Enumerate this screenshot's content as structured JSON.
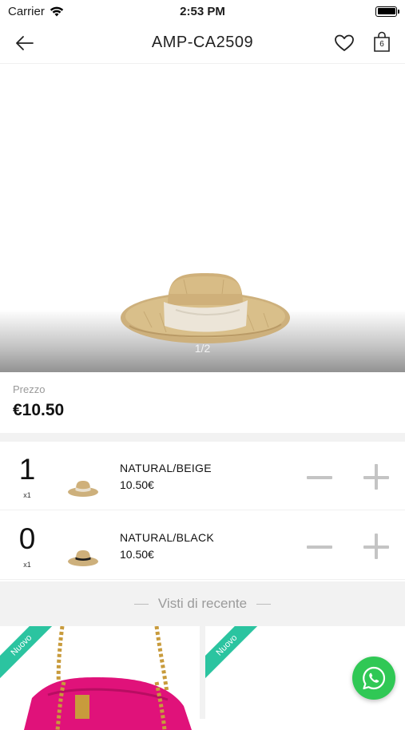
{
  "status_bar": {
    "carrier": "Carrier",
    "time": "2:53 PM"
  },
  "nav": {
    "title": "AMP-CA2509",
    "cart_count": "6"
  },
  "gallery": {
    "page_indicator": "1/2"
  },
  "price": {
    "label": "Prezzo",
    "value": "€10.50"
  },
  "variants": [
    {
      "quantity": "1",
      "unit": "x1",
      "name": "NATURAL/BEIGE",
      "price": "10.50€",
      "band_color": "#e9e0cf"
    },
    {
      "quantity": "0",
      "unit": "x1",
      "name": "NATURAL/BLACK",
      "price": "10.50€",
      "band_color": "#1d1d1d"
    }
  ],
  "recent": {
    "title": "Visti di recente",
    "products": [
      {
        "badge": "Nuovo"
      },
      {
        "badge": "Nuovo"
      }
    ]
  },
  "colors": {
    "ribbon": "#2bc4a0",
    "whatsapp": "#30c855",
    "bag_pink": "#e0127a"
  }
}
